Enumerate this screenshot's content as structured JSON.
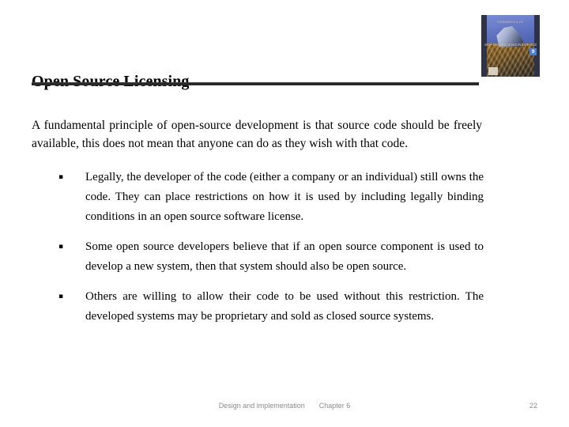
{
  "slide": {
    "title": "Open Source Licensing",
    "intro": "A fundamental principle of open-source development is that source code should be freely available, this does not mean that anyone can do as they wish with that code.",
    "bullet_marker": "▪",
    "bullets": [
      "Legally, the developer of the code (either a company or an individual) still owns the code. They can place restrictions on how it is used by including legally binding conditions in an open source software license.",
      "Some open source developers believe that if an open source component is used to develop a new system, then that system should also be open source.",
      "Others are willing to allow their code to be used without this restriction. The developed systems may be proprietary and sold as closed source systems."
    ]
  },
  "book_cover": {
    "author": "SOMMERVILLE",
    "title": "SOFTWARE ENGINEERING",
    "edition": "9"
  },
  "footer": {
    "topic": "Design and implementation",
    "chapter": "Chapter 6",
    "page_number": "22"
  },
  "colors": {
    "text": "#000000",
    "rule": "#1b1b1b",
    "footer_text": "#8b8b8b",
    "background": "#ffffff"
  }
}
